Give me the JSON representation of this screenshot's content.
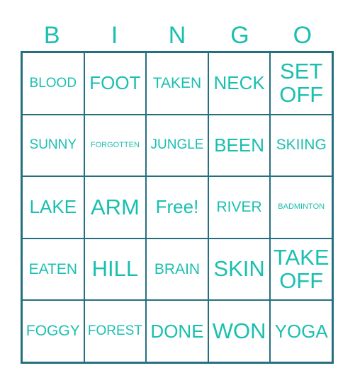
{
  "header": [
    "B",
    "I",
    "N",
    "G",
    "O"
  ],
  "accent_color": "#1abfb0",
  "border_color": "#25707f",
  "cells": [
    [
      "BLOOD",
      "FOOT",
      "TAKEN",
      "NECK",
      "SET OFF"
    ],
    [
      "SUNNY",
      "FORGOTTEN",
      "JUNGLE",
      "BEEN",
      "SKIING"
    ],
    [
      "LAKE",
      "ARM",
      "Free!",
      "RIVER",
      "BADMINTON"
    ],
    [
      "EATEN",
      "HILL",
      "BRAIN",
      "SKIN",
      "TAKE OFF"
    ],
    [
      "FOGGY",
      "FOREST",
      "DONE",
      "WON",
      "YOGA"
    ]
  ]
}
